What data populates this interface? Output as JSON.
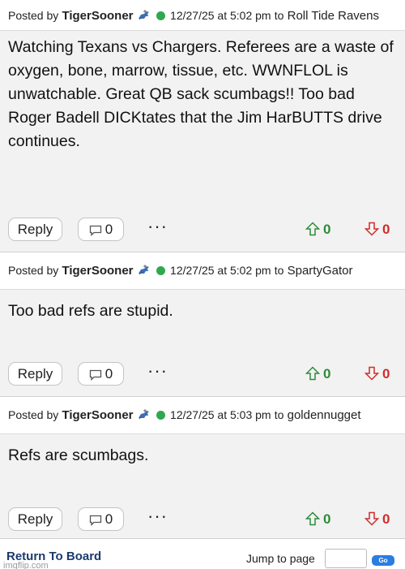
{
  "posts": [
    {
      "posted_by_label": "Posted by",
      "author": "TigerSooner",
      "timestamp": "12/27/25 at 5:02 pm",
      "to_label": "to",
      "recipient": "Roll Tide Ravens",
      "body": "Watching Texans vs Chargers. Referees are a waste of oxygen, bone, marrow, tissue, etc. WWNFLOL is unwatchable. Great QB sack scumbags!! Too bad Roger Badell DICKtates that the Jim HarBUTTS drive continues.",
      "reply_label": "Reply",
      "comment_count": "0",
      "more_label": "···",
      "upvotes": "0",
      "downvotes": "0"
    },
    {
      "posted_by_label": "Posted by",
      "author": "TigerSooner",
      "timestamp": "12/27/25 at 5:02 pm",
      "to_label": "to",
      "recipient": "SpartyGator",
      "body": "Too bad refs are stupid.",
      "reply_label": "Reply",
      "comment_count": "0",
      "more_label": "···",
      "upvotes": "0",
      "downvotes": "0"
    },
    {
      "posted_by_label": "Posted by",
      "author": "TigerSooner",
      "timestamp": "12/27/25 at 5:03 pm",
      "to_label": "to",
      "recipient": "goldennugget",
      "body": "Refs are scumbags.",
      "reply_label": "Reply",
      "comment_count": "0",
      "more_label": "···",
      "upvotes": "0",
      "downvotes": "0"
    }
  ],
  "footer": {
    "return_label": "Return To Board",
    "jump_label": "Jump to page",
    "go_label": "Go",
    "watermark": "imgflip.com"
  },
  "colors": {
    "online_dot": "#2fa84f",
    "upvote": "#2e8b3a",
    "downvote": "#d12b2b",
    "link": "#1b3a6b",
    "go_button": "#2a7de1"
  },
  "icons": {
    "user_badge": "horse-rider-icon",
    "online": "online-status-icon",
    "comment": "comment-bubble-icon",
    "upvote": "arrow-up-icon",
    "downvote": "arrow-down-icon"
  }
}
